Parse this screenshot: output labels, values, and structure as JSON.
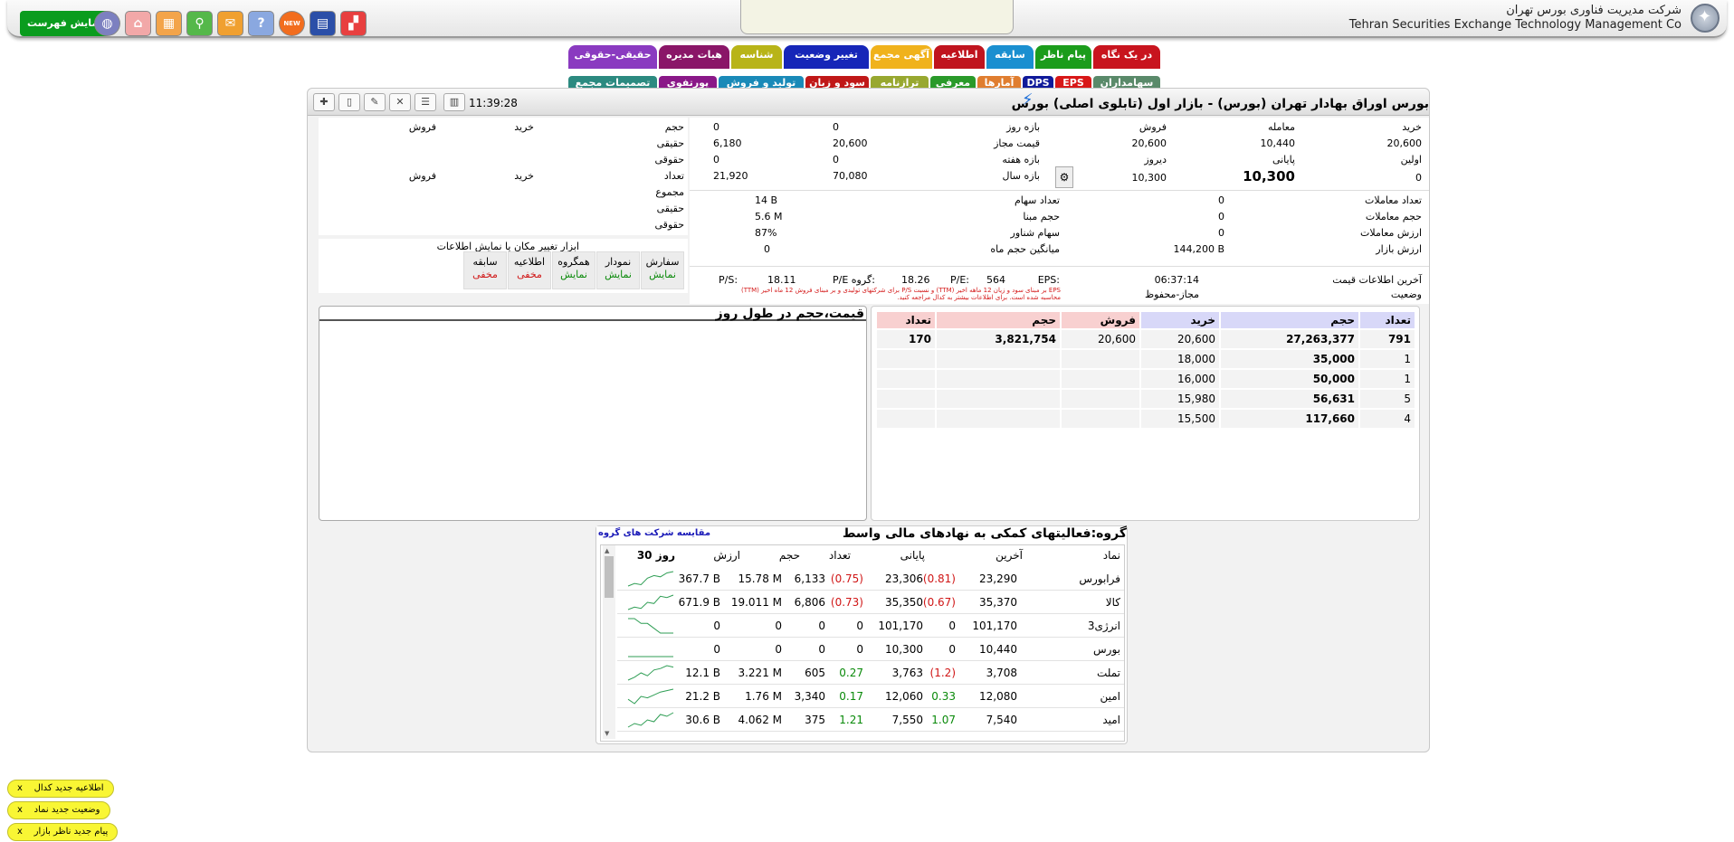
{
  "header": {
    "company_fa": "شرکت مدیریت فناوری بورس تهران",
    "company_en": "Tehran Securities Exchange Technology Management Co",
    "show_list_label": "نمایش فهرست",
    "new_badge": "NEW"
  },
  "tabs_row1": [
    "در یک نگاه",
    "پیام ناظر",
    "سابقه",
    "اطلاعیه",
    "آگهی مجمع",
    "تغییر وضعیت",
    "شناسه",
    "هیات مدیره",
    "حقیقی-حقوقی"
  ],
  "tabs_row2": [
    "سهامداران",
    "EPS",
    "DPS",
    "آمارها",
    "معرفی",
    "ترازنامه",
    "سود و زیان",
    "تولید و فروش",
    "پورتفوی",
    "تصمیمات مجمع"
  ],
  "symbol": {
    "title": "بورس اوراق بهادار تهران (بورس) - بازار اول (تابلوی اصلی) بورس",
    "time": "11:39:28"
  },
  "price_block": {
    "labels": {
      "buy": "خرید",
      "trade": "معامله",
      "sell": "فروش",
      "day_range": "بازه روز",
      "first": "اولین",
      "last": "پایانی",
      "yesterday": "دیروز",
      "allowed": "قیمت مجاز",
      "week_range": "بازه هفته",
      "year_range": "بازه سال"
    },
    "buy": "20,600",
    "trade": "10,440",
    "sell": "20,600",
    "day_range_hi": "0",
    "day_range_lo": "0",
    "first": "0",
    "last": "10,300",
    "yesterday": "10,300",
    "allowed_hi": "20,600",
    "allowed_lo": "6,180",
    "week_hi": "0",
    "week_lo": "0",
    "year_hi": "70,080",
    "year_lo": "21,920"
  },
  "stats": {
    "labels": {
      "count": "تعداد معاملات",
      "volume": "حجم معاملات",
      "value": "ارزش معاملات",
      "mcap": "ارزش بازار",
      "shares": "تعداد سهام",
      "base": "حجم مبنا",
      "float": "سهام شناور",
      "avg": "میانگین حجم ماه",
      "last_info": "آخرین اطلاعات قیمت",
      "status": "وضعیت"
    },
    "count": "0",
    "volume": "0",
    "value": "0",
    "mcap": "144,200 B",
    "shares": "14 B",
    "base": "5.6 M",
    "float": "87%",
    "avg": "0",
    "last_info": "06:37:14",
    "status": "مجاز-محفوظ"
  },
  "ratios": {
    "eps_label": "EPS:",
    "eps": "564",
    "pe_label": "P/E:",
    "pe": "18.26",
    "gpe_label": "P/E گروه:",
    "gpe": "18.11",
    "ps_label": "P/S:",
    "note1": "EPS بر مبنای سود و زیان 12 ماهه اخیر (TTM) و نسبت P/S برای شرکتهای تولیدی و بر مبنای فروش 12 ماه اخیر (TTM)",
    "note2": "محاسبه شده است. برای اطلاعات بیشتر به کدال مراجعه کنید."
  },
  "legal": {
    "labels": {
      "volume": "حجم",
      "real": "حقیقی",
      "legal": "حقوقی",
      "count": "تعداد",
      "total": "مجموع",
      "buy": "خرید",
      "sell": "فروش"
    }
  },
  "tools": {
    "title": "ابزار تغییر مکان یا نمایش اطلاعات",
    "buttons": [
      {
        "label": "سفارش",
        "state": "نمایش"
      },
      {
        "label": "نمودار",
        "state": "نمایش"
      },
      {
        "label": "همگروه",
        "state": "نمایش"
      },
      {
        "label": "اطلاعیه",
        "state": "مخفی"
      },
      {
        "label": "سابقه",
        "state": "مخفی"
      }
    ]
  },
  "orderbook": {
    "headers": {
      "count": "تعداد",
      "volume": "حجم",
      "buy": "خرید",
      "sell": "فروش",
      "svolume": "حجم",
      "scount": "تعداد"
    },
    "rows": [
      {
        "bc": "791",
        "bv": "27,263,377",
        "bp": "20,600",
        "sp": "20,600",
        "sv": "3,821,754",
        "sc": "170"
      },
      {
        "bc": "1",
        "bv": "35,000",
        "bp": "18,000",
        "sp": "",
        "sv": "",
        "sc": ""
      },
      {
        "bc": "1",
        "bv": "50,000",
        "bp": "16,000",
        "sp": "",
        "sv": "",
        "sc": ""
      },
      {
        "bc": "5",
        "bv": "56,631",
        "bp": "15,980",
        "sp": "",
        "sv": "",
        "sc": ""
      },
      {
        "bc": "4",
        "bv": "117,660",
        "bp": "15,500",
        "sp": "",
        "sv": "",
        "sc": ""
      }
    ]
  },
  "chart_panel": {
    "title": "قیمت،حجم در طول روز"
  },
  "group": {
    "title": "گروه:فعالیتهای کمکی به نهادهای مالی واسط",
    "compare_link": "مقایسه شرکت های گروه",
    "headers": {
      "symbol": "نماد",
      "last": "آخرین",
      "close": "پایانی",
      "count": "تعداد",
      "volume": "حجم",
      "value": "ارزش",
      "days": "30 روز"
    },
    "rows": [
      {
        "symbol": "فرابورس",
        "last": "23,290",
        "lchg": "(0.81)",
        "close": "23,306",
        "cchg": "(0.75)",
        "count": "6,133",
        "volume": "15.78 M",
        "value": "367.7 B",
        "tone": "neg",
        "spark": [
          8,
          10,
          9,
          14,
          16,
          15,
          18,
          19
        ]
      },
      {
        "symbol": "کالا",
        "last": "35,370",
        "lchg": "(0.67)",
        "close": "35,350",
        "cchg": "(0.73)",
        "count": "6,806",
        "volume": "19.011 M",
        "value": "671.9 B",
        "tone": "neg",
        "spark": [
          6,
          8,
          7,
          12,
          11,
          17,
          16,
          18
        ]
      },
      {
        "symbol": "انرژی3",
        "last": "101,170",
        "lchg": "0",
        "close": "101,170",
        "cchg": "0",
        "count": "0",
        "volume": "0",
        "value": "0",
        "tone": "zero",
        "spark": [
          14,
          14,
          13,
          13,
          12,
          11,
          11,
          11
        ]
      },
      {
        "symbol": "بورس",
        "last": "10,440",
        "lchg": "0",
        "close": "10,300",
        "cchg": "0",
        "count": "0",
        "volume": "0",
        "value": "0",
        "tone": "zero",
        "spark": [
          12,
          12,
          12,
          12,
          12,
          12,
          12,
          12
        ]
      },
      {
        "symbol": "تملت",
        "last": "3,708",
        "lchg": "(1.2)",
        "close": "3,763",
        "cchg": "0.27",
        "count": "605",
        "volume": "3.221 M",
        "value": "12.1 B",
        "tone": "mix",
        "spark": [
          7,
          9,
          12,
          10,
          14,
          15,
          17,
          16
        ]
      },
      {
        "symbol": "امین",
        "last": "12,080",
        "lchg": "0.33",
        "close": "12,060",
        "cchg": "0.17",
        "count": "3,340",
        "volume": "1.76 M",
        "value": "21.2 B",
        "tone": "pos",
        "spark": [
          10,
          7,
          12,
          11,
          13,
          15,
          16,
          17
        ]
      },
      {
        "symbol": "امید",
        "last": "7,540",
        "lchg": "1.07",
        "close": "7,550",
        "cchg": "1.21",
        "count": "375",
        "volume": "4.062 M",
        "value": "30.6 B",
        "tone": "pos",
        "spark": [
          9,
          11,
          10,
          13,
          12,
          16,
          15,
          17
        ]
      }
    ]
  },
  "notifications": [
    {
      "text": "اطلاعیه جدید کدال",
      "close": "x"
    },
    {
      "text": "وضعیت جدید نماد",
      "close": "x"
    },
    {
      "text": "پیام جدید ناظر بازار",
      "close": "x"
    }
  ],
  "colors": {
    "buy_header": "#d8d8f8",
    "sell_header": "#f8d0d0",
    "positive": "#0a8a0a",
    "negative": "#d01616"
  }
}
